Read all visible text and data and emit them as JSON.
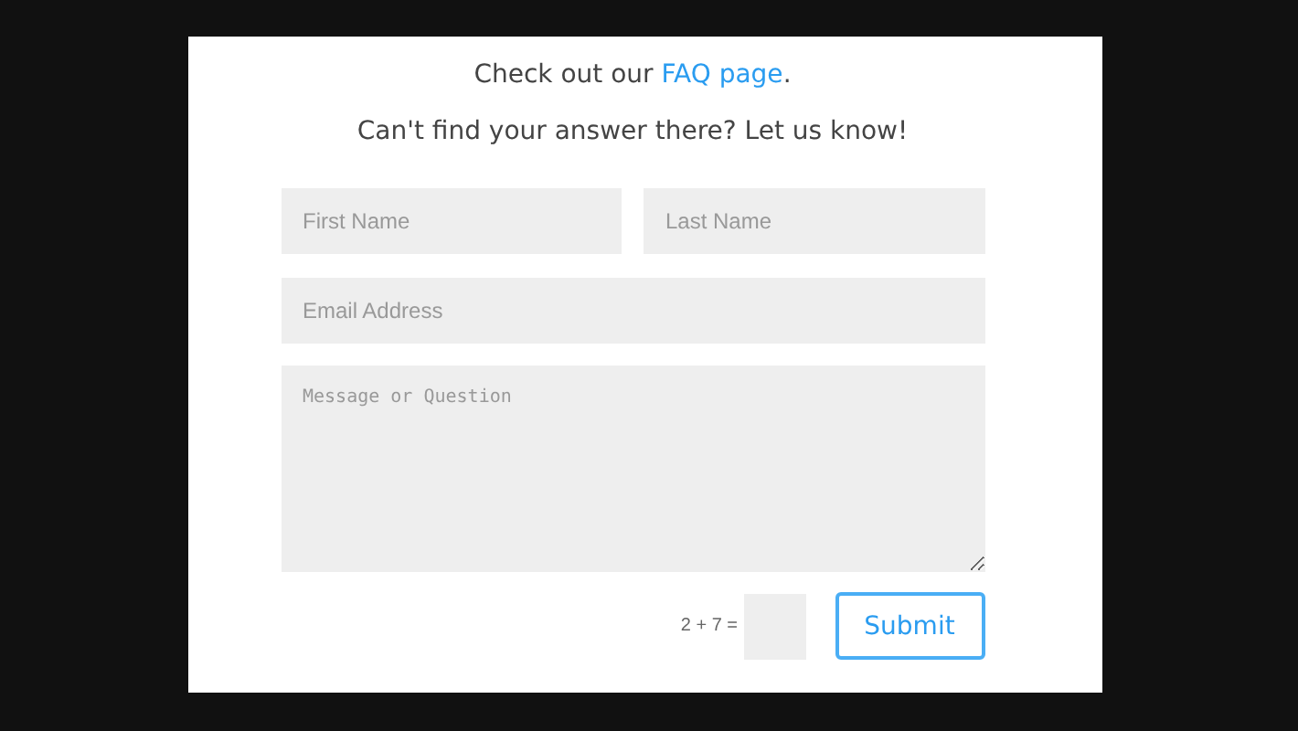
{
  "intro": {
    "before": "Check out our ",
    "link": "FAQ page",
    "after": "."
  },
  "subheading": "Can't find your answer there? Let us know!",
  "fields": {
    "first_name": {
      "placeholder": "First Name"
    },
    "last_name": {
      "placeholder": "Last Name"
    },
    "email": {
      "placeholder": "Email Address"
    },
    "message": {
      "placeholder": "Message or Question"
    }
  },
  "captcha": {
    "question": "2 + 7 ="
  },
  "submit": "Submit"
}
